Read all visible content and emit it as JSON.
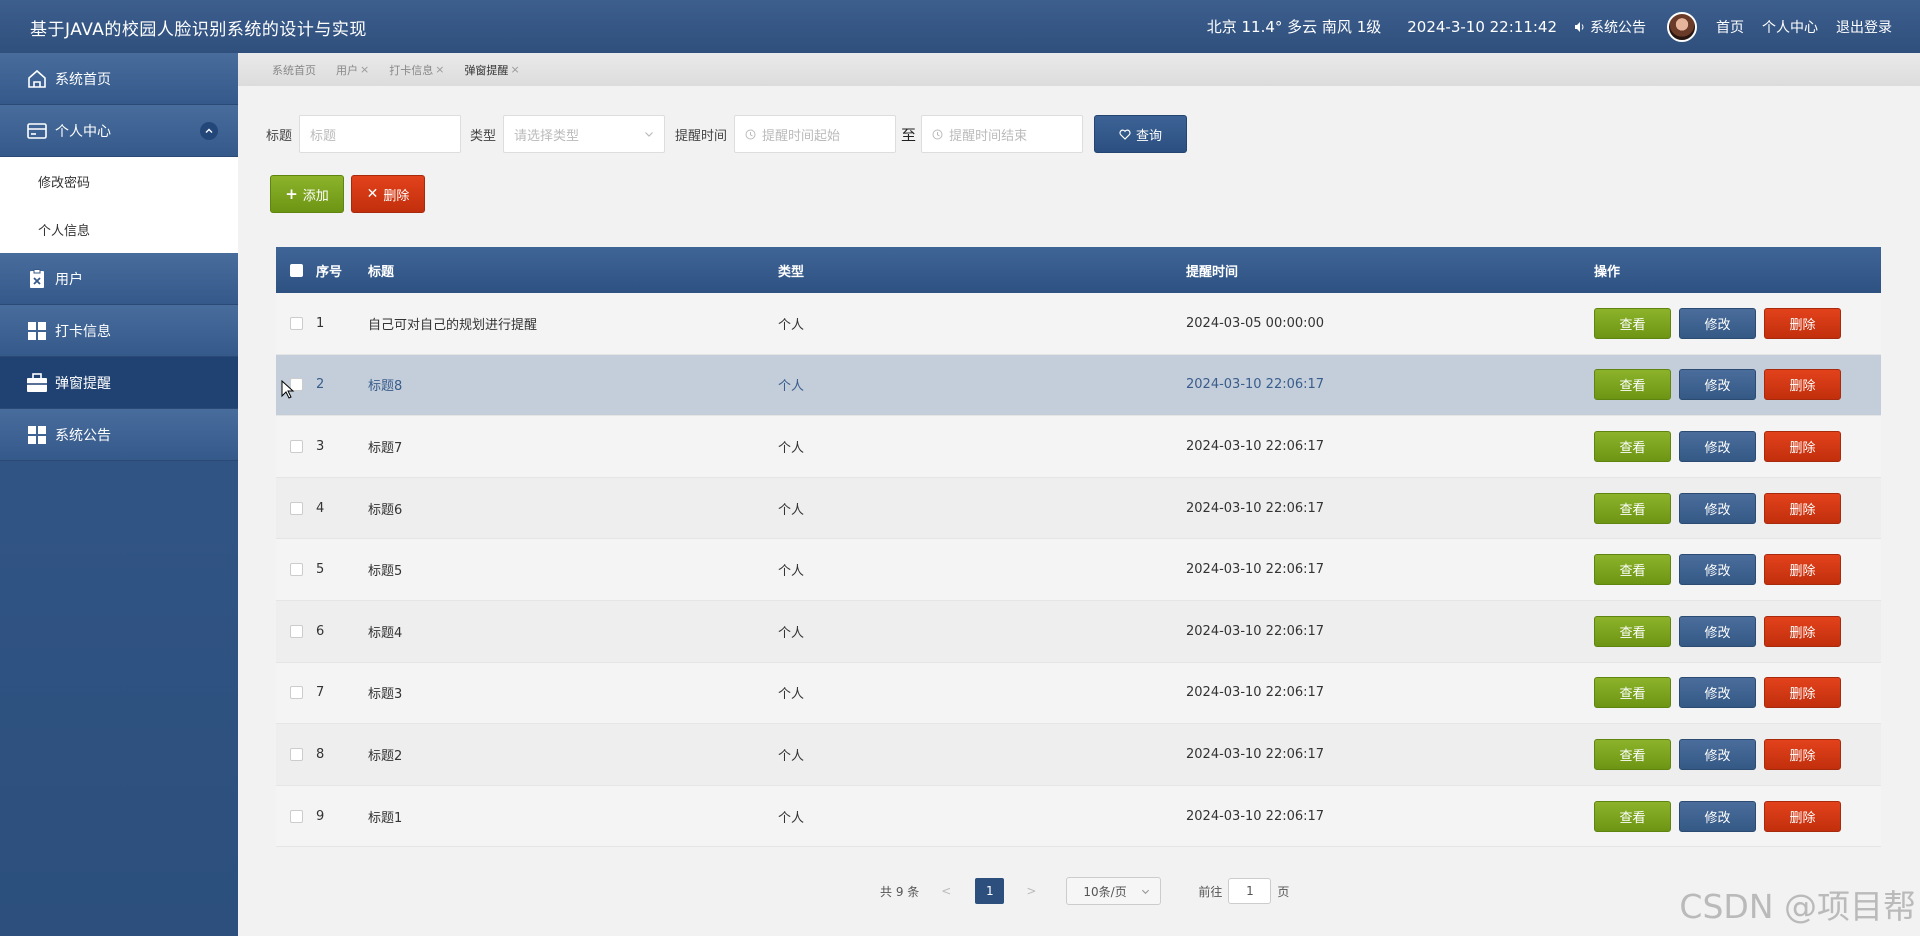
{
  "header": {
    "title": "基于JAVA的校园人脸识别系统的设计与实现",
    "weather": "北京  11.4°  多云  南风  1级",
    "datetime": "2024-3-10 22:11:42",
    "notice": "系统公告",
    "nav": [
      "首页",
      "个人中心",
      "退出登录"
    ]
  },
  "sidebar": {
    "items": [
      {
        "label": "系统首页",
        "icon": "home-icon"
      },
      {
        "label": "个人中心",
        "icon": "card-icon"
      },
      {
        "label": "用户",
        "icon": "clipboard-icon"
      },
      {
        "label": "打卡信息",
        "icon": "grid-icon"
      },
      {
        "label": "弹窗提醒",
        "icon": "briefcase-icon"
      },
      {
        "label": "系统公告",
        "icon": "grid-icon"
      }
    ],
    "submenu": [
      "修改密码",
      "个人信息"
    ]
  },
  "tabs": [
    {
      "label": "系统首页"
    },
    {
      "label": "用户"
    },
    {
      "label": "打卡信息"
    },
    {
      "label": "弹窗提醒"
    }
  ],
  "search": {
    "title_label": "标题",
    "title_placeholder": "标题",
    "type_label": "类型",
    "type_placeholder": "请选择类型",
    "time_label": "提醒时间",
    "time_start_placeholder": "提醒时间起始",
    "to_label": "至",
    "time_end_placeholder": "提醒时间结束",
    "query_label": "查询"
  },
  "actions": {
    "add_label": "添加",
    "delete_label": "删除"
  },
  "table": {
    "headers": [
      "序号",
      "标题",
      "类型",
      "提醒时间",
      "操作"
    ],
    "rows": [
      {
        "idx": "1",
        "title": "自己可对自己的规划进行提醒",
        "type": "个人",
        "time": "2024-03-05 00:00:00"
      },
      {
        "idx": "2",
        "title": "标题8",
        "type": "个人",
        "time": "2024-03-10 22:06:17"
      },
      {
        "idx": "3",
        "title": "标题7",
        "type": "个人",
        "time": "2024-03-10 22:06:17"
      },
      {
        "idx": "4",
        "title": "标题6",
        "type": "个人",
        "time": "2024-03-10 22:06:17"
      },
      {
        "idx": "5",
        "title": "标题5",
        "type": "个人",
        "time": "2024-03-10 22:06:17"
      },
      {
        "idx": "6",
        "title": "标题4",
        "type": "个人",
        "time": "2024-03-10 22:06:17"
      },
      {
        "idx": "7",
        "title": "标题3",
        "type": "个人",
        "time": "2024-03-10 22:06:17"
      },
      {
        "idx": "8",
        "title": "标题2",
        "type": "个人",
        "time": "2024-03-10 22:06:17"
      },
      {
        "idx": "9",
        "title": "标题1",
        "type": "个人",
        "time": "2024-03-10 22:06:17"
      }
    ],
    "op_view": "查看",
    "op_edit": "修改",
    "op_delete": "删除"
  },
  "pager": {
    "total": "共 9 条",
    "prev": "<",
    "current": "1",
    "next": ">",
    "size": "10条/页",
    "goto_label": "前往",
    "goto_value": "1",
    "page_suffix": "页"
  },
  "watermark": "CSDN @项目帮",
  "colors": {
    "primary": "#2d5282",
    "green": "#7aa31b",
    "red": "#d2380f",
    "blue": "#3f6496"
  }
}
